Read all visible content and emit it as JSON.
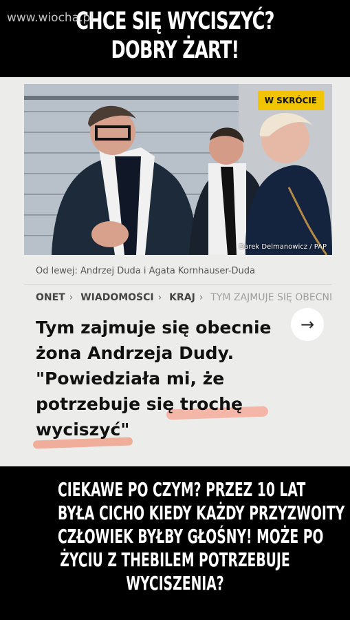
{
  "watermark": "www.wiocha.pl",
  "top_title": [
    "CHCE SIĘ WYCISZYĆ?",
    "DOBRY ŻART!"
  ],
  "article": {
    "badge": "W SKRÓCIE",
    "credit": "Darek Delmanowicz / PAP",
    "caption": "Od lewej: Andrzej Duda i Agata Kornhauser-Duda",
    "breadcrumb": [
      "ONET",
      "WIADOMOŚCI",
      "KRAJ",
      "TYM ZAJMUJE SIĘ OBECNIE ŻO"
    ],
    "headline": [
      "Tym zajmuje się obecnie",
      "żona Andrzeja Dudy.",
      "\"Powiedziała mi, że",
      "potrzebuje się trochę",
      "wyciszyć\""
    ]
  },
  "bottom_text": [
    "CIEKAWE PO CZYM? PRZEZ 10 LAT",
    "BYŁA CICHO KIEDY KAŻDY PRZYZWOITY",
    "CZŁOWIEK BYŁBY GŁOŚNY! MOŻE PO",
    "ŻYCIU Z THEBILEM POTRZEBUJE",
    "WYCISZENIA?"
  ],
  "colors": {
    "badge": "#f2c400",
    "highlight": "#f4b6a6",
    "text": "#111111",
    "background": "#000000"
  }
}
